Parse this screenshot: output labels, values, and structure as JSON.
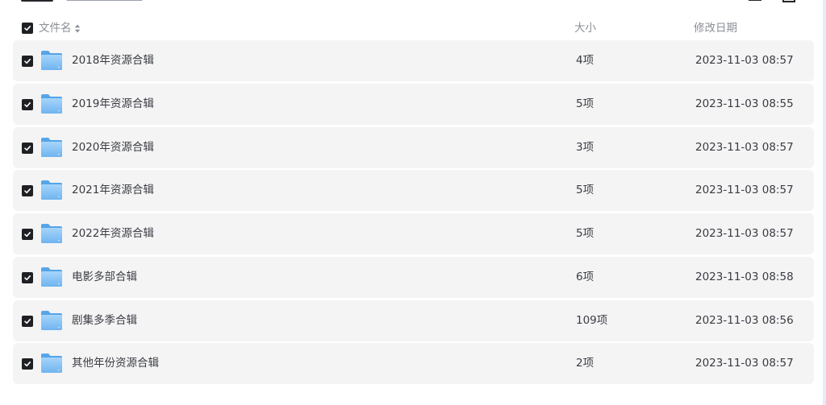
{
  "header": {
    "name_label": "文件名",
    "size_label": "大小",
    "date_label": "修改日期"
  },
  "colors": {
    "checkbox": "#1f2023",
    "row_background": "#f4f4f5",
    "folder_blue": "#7fbff2",
    "header_text": "#8c8f97"
  },
  "rows": [
    {
      "name": "2018年资源合辑",
      "size": "4项",
      "date": "2023-11-03 08:57",
      "checked": true,
      "icon": "folder-icon"
    },
    {
      "name": "2019年资源合辑",
      "size": "5项",
      "date": "2023-11-03 08:55",
      "checked": true,
      "icon": "folder-icon"
    },
    {
      "name": "2020年资源合辑",
      "size": "3项",
      "date": "2023-11-03 08:57",
      "checked": true,
      "icon": "folder-icon"
    },
    {
      "name": "2021年资源合辑",
      "size": "5项",
      "date": "2023-11-03 08:57",
      "checked": true,
      "icon": "folder-icon"
    },
    {
      "name": "2022年资源合辑",
      "size": "5项",
      "date": "2023-11-03 08:57",
      "checked": true,
      "icon": "folder-icon"
    },
    {
      "name": "电影多部合辑",
      "size": "6项",
      "date": "2023-11-03 08:58",
      "checked": true,
      "icon": "folder-icon"
    },
    {
      "name": "剧集多季合辑",
      "size": "109项",
      "date": "2023-11-03 08:56",
      "checked": true,
      "icon": "folder-icon"
    },
    {
      "name": "其他年份资源合辑",
      "size": "2项",
      "date": "2023-11-03 08:57",
      "checked": true,
      "icon": "folder-icon"
    }
  ]
}
